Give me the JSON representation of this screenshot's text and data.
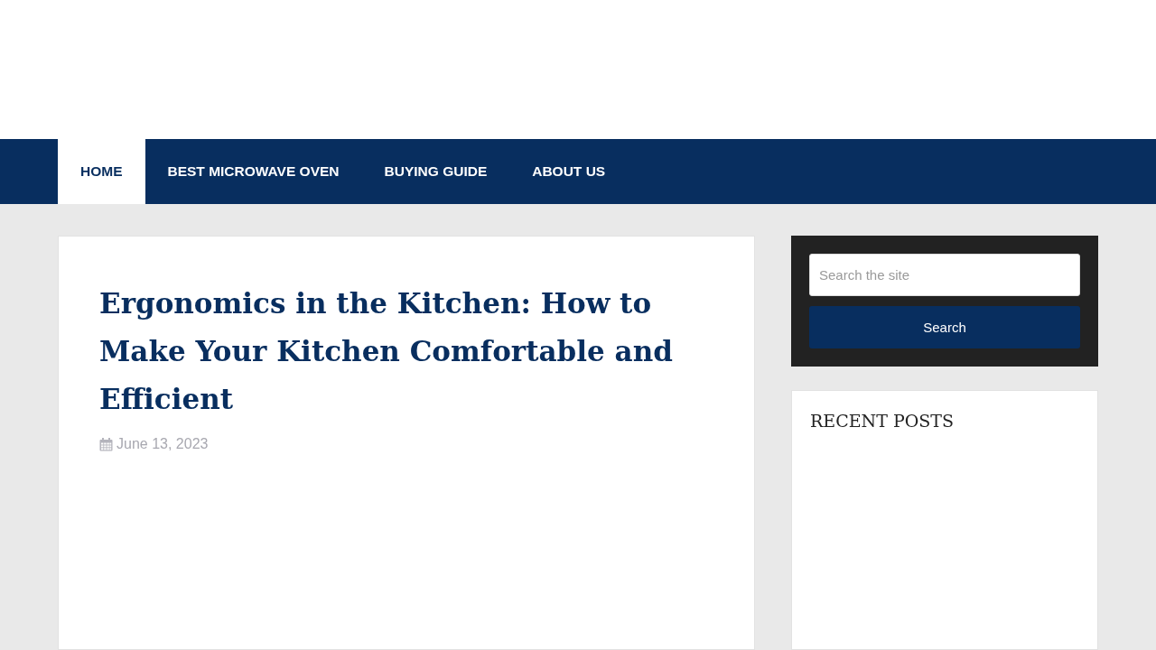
{
  "nav": {
    "items": [
      {
        "label": "HOME",
        "selected": true
      },
      {
        "label": "BEST MICROWAVE OVEN",
        "selected": false
      },
      {
        "label": "BUYING GUIDE",
        "selected": false
      },
      {
        "label": "ABOUT US",
        "selected": false
      }
    ]
  },
  "article": {
    "title": "Ergonomics in the Kitchen: How to Make Your Kitchen Comfortable and Efficient",
    "date": "June 13, 2023"
  },
  "sidebar": {
    "search": {
      "placeholder": "Search the site",
      "button": "Search"
    },
    "recent_posts": {
      "title": "RECENT POSTS"
    }
  }
}
